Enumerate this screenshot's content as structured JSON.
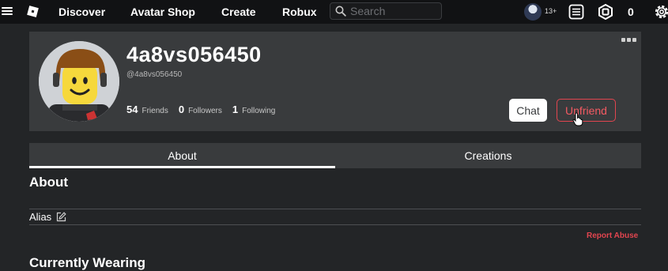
{
  "nav": {
    "links": [
      {
        "label": "Discover"
      },
      {
        "label": "Avatar Shop"
      },
      {
        "label": "Create"
      },
      {
        "label": "Robux"
      }
    ],
    "search_placeholder": "Search",
    "age_badge": "13+",
    "robux_count": "0",
    "icons": [
      "hamburger-menu-icon",
      "roblox-logo-icon",
      "search-icon",
      "chat-list-icon",
      "robux-icon",
      "settings-gear-icon"
    ]
  },
  "profile": {
    "display_name": "4a8vs056450",
    "username": "@4a8vs056450",
    "stats": [
      {
        "count": "54",
        "label": "Friends"
      },
      {
        "count": "0",
        "label": "Followers"
      },
      {
        "count": "1",
        "label": "Following"
      }
    ],
    "chat_label": "Chat",
    "unfriend_label": "Unfriend"
  },
  "tabs": [
    {
      "label": "About",
      "active": true
    },
    {
      "label": "Creations",
      "active": false
    }
  ],
  "about": {
    "heading": "About",
    "alias_label": "Alias",
    "report_abuse": "Report Abuse",
    "next_heading": "Currently Wearing"
  },
  "colors": {
    "background": "#232527",
    "topbar": "#111214",
    "card": "#393b3d",
    "danger": "#e2454f"
  }
}
